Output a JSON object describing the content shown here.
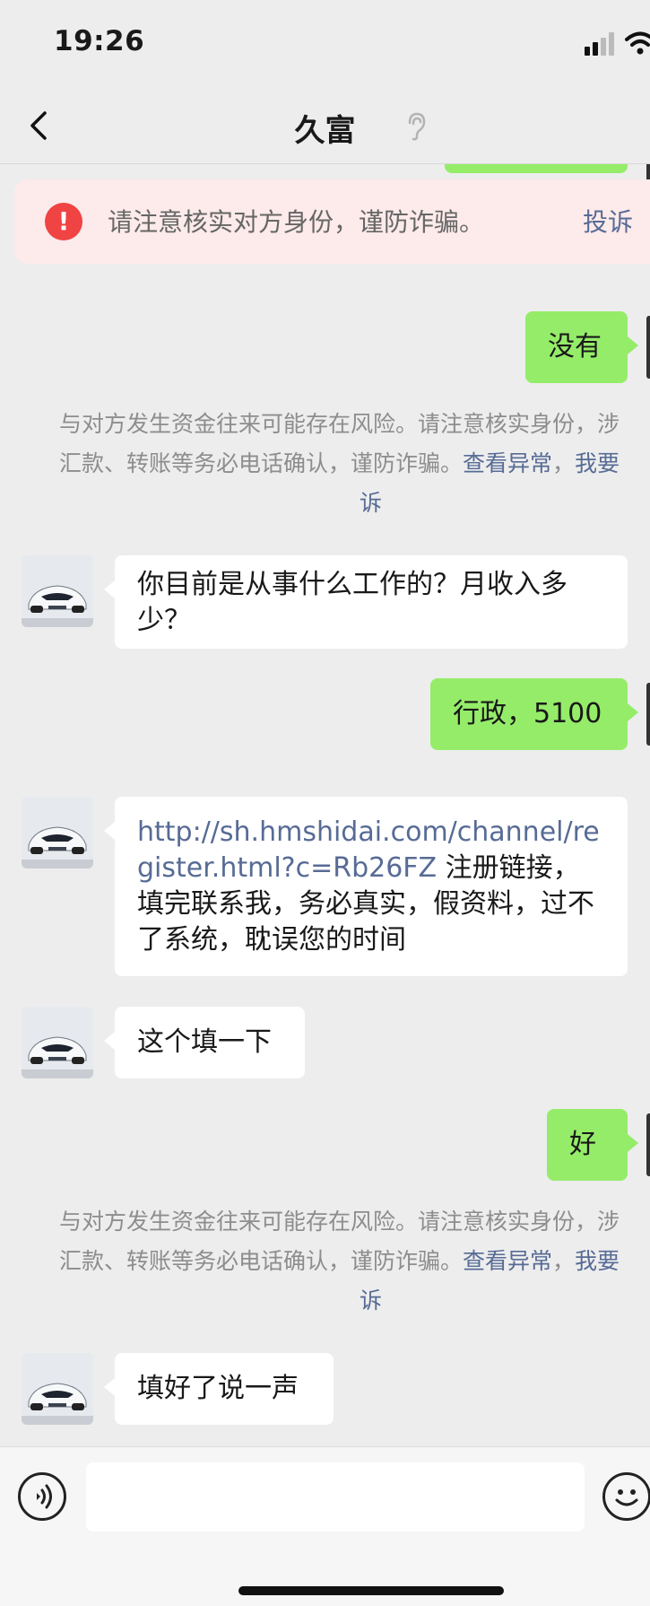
{
  "status_bar": {
    "time": "19:26"
  },
  "nav": {
    "title": "久富"
  },
  "warning": {
    "icon": "!",
    "text": "请注意核实对方身份，谨防诈骗。",
    "action": "投诉"
  },
  "messages": [
    {
      "side": "out",
      "text": "没有"
    },
    {
      "side": "in",
      "text": "你目前是从事什么工作的？月收入多少？"
    },
    {
      "side": "out",
      "text": "行政，5100"
    },
    {
      "side": "in",
      "link": "http://sh.hmshidai.com/channel/register.html?c=Rb26FZ",
      "text": "注册链接，填完联系我，务必真实，假资料，过不了系统，耽误您的时间"
    },
    {
      "side": "in",
      "text": "这个填一下"
    },
    {
      "side": "out",
      "text": "好"
    },
    {
      "side": "in",
      "text": "填好了说一声"
    }
  ],
  "system_notice": {
    "line1": "与对方发生资金往来可能存在风险。请注意核实身份，涉",
    "line2": "汇款、转账等务必电话确认，谨防诈骗。",
    "view_abnormal": "查看异常",
    "separator": "，",
    "report_part1": "我要",
    "report_part2": "诉"
  },
  "icons": {
    "back": "chevron-left-icon",
    "mute": "ear-off-icon",
    "voice": "voice-icon",
    "emoji": "emoji-icon",
    "signal": "signal-icon",
    "wifi": "wifi-icon"
  },
  "colors": {
    "background": "#ededed",
    "outgoing_bubble": "#95ec69",
    "incoming_bubble": "#ffffff",
    "link": "#576b95",
    "warning_bg": "#fdeaea",
    "warning_icon": "#f04343"
  }
}
